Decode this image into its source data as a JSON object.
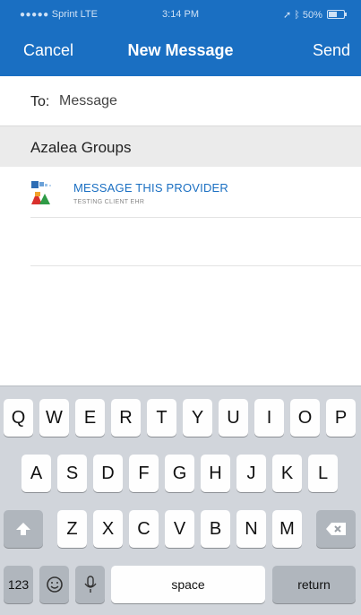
{
  "status_bar": {
    "carrier": "Sprint",
    "network": "LTE",
    "time": "3:14 PM",
    "battery": "50%"
  },
  "nav": {
    "cancel_label": "Cancel",
    "title": "New Message",
    "send_label": "Send"
  },
  "compose": {
    "to_label": "To:",
    "to_placeholder": "Message"
  },
  "groups": [
    {
      "title": "Azalea Groups",
      "items": [
        {
          "name": "MESSAGE THIS PROVIDER",
          "subtitle": "TESTING CLIENT EHR"
        }
      ]
    }
  ],
  "keyboard": {
    "row1": [
      "Q",
      "W",
      "E",
      "R",
      "T",
      "Y",
      "U",
      "I",
      "O",
      "P"
    ],
    "row2": [
      "A",
      "S",
      "D",
      "F",
      "G",
      "H",
      "J",
      "K",
      "L"
    ],
    "row3": [
      "Z",
      "X",
      "C",
      "V",
      "B",
      "N",
      "M"
    ],
    "numbers_label": "123",
    "space_label": "space",
    "return_label": "return"
  },
  "colors": {
    "brand_blue": "#1a6fc2",
    "group_header_bg": "#ebebeb",
    "keyboard_bg": "#d1d5db"
  },
  "icons": [
    "signal-dots-icon",
    "location-arrow-icon",
    "bluetooth-icon",
    "battery-icon",
    "azalea-logo-icon",
    "shift-icon",
    "backspace-icon",
    "emoji-icon",
    "microphone-icon"
  ]
}
